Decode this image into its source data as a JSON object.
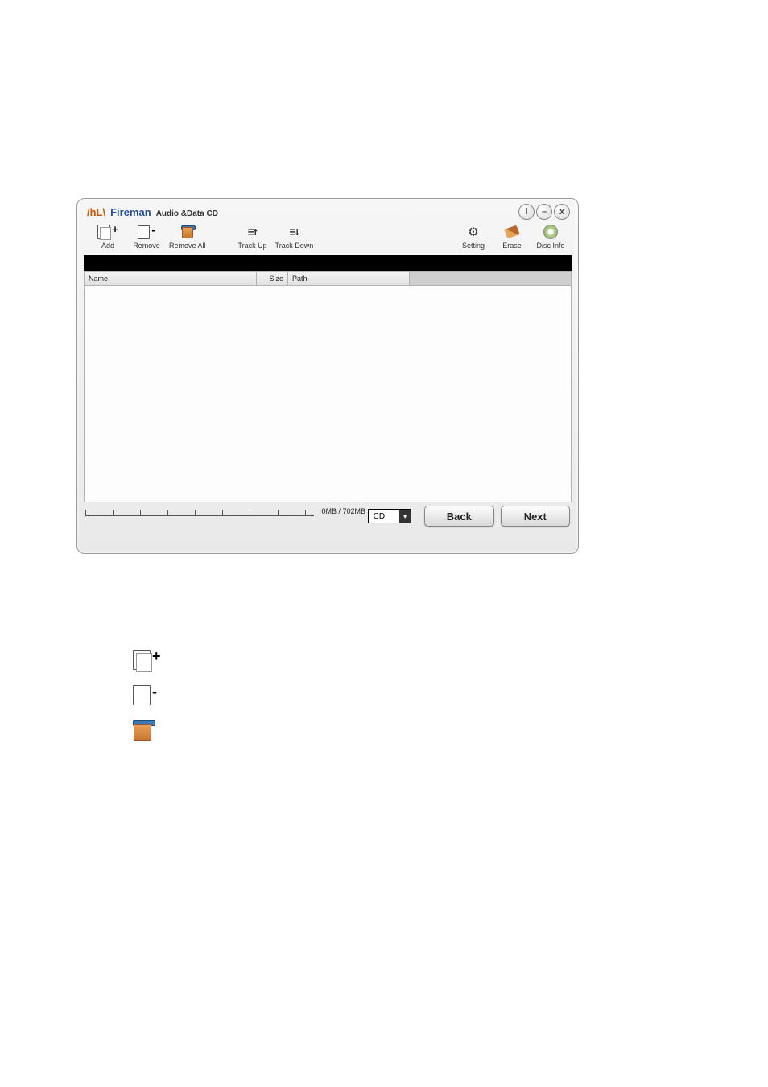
{
  "title": {
    "brand": "Fireman",
    "sub": "Audio &Data CD",
    "flame": "/hL\\"
  },
  "window_buttons": {
    "info": "i",
    "minimize": "–",
    "close": "x"
  },
  "toolbar": {
    "left": [
      {
        "key": "add",
        "label": "Add"
      },
      {
        "key": "remove",
        "label": "Remove"
      },
      {
        "key": "removeall",
        "label": "Remove All"
      }
    ],
    "mid": [
      {
        "key": "trackup",
        "label": "Track Up"
      },
      {
        "key": "trackdown",
        "label": "Track Down"
      }
    ],
    "right": [
      {
        "key": "setting",
        "label": "Setting"
      },
      {
        "key": "erase",
        "label": "Erase"
      },
      {
        "key": "discinfo",
        "label": "Disc Info"
      }
    ]
  },
  "columns": {
    "name": "Name",
    "size": "Size",
    "path": "Path"
  },
  "capacity": "0MB / 702MB",
  "disc_type": "CD",
  "nav": {
    "back": "Back",
    "next": "Next"
  }
}
